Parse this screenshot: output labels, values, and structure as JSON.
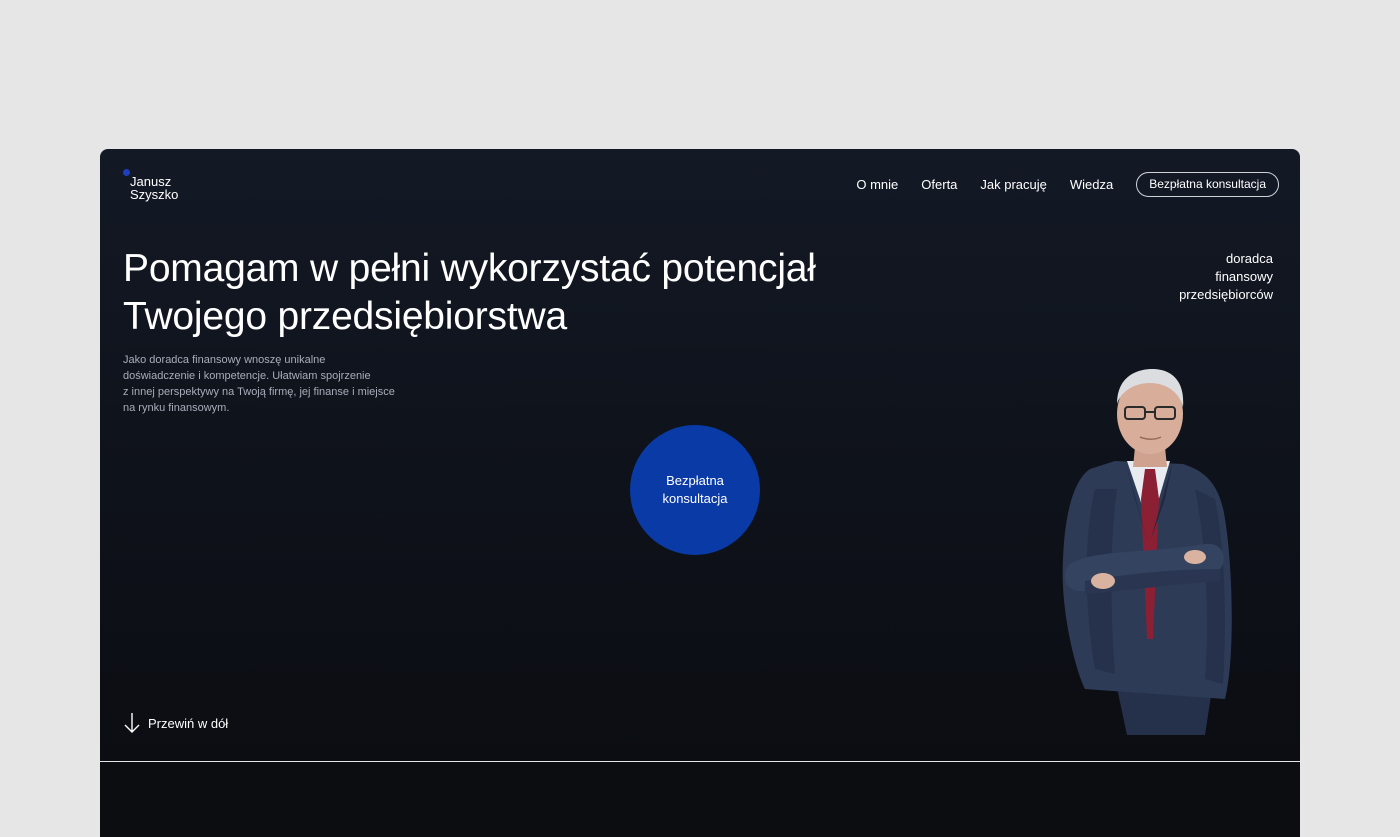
{
  "logo": {
    "line1": "Janusz",
    "line2": "Szyszko",
    "dot_color": "#1d3fbf"
  },
  "nav": {
    "items": [
      {
        "label": "O mnie"
      },
      {
        "label": "Oferta"
      },
      {
        "label": "Jak pracuję"
      },
      {
        "label": "Wiedza"
      }
    ],
    "cta_label": "Bezpłatna konsultacja"
  },
  "hero": {
    "headline_line1": "Pomagam w pełni wykorzystać potencjał",
    "headline_line2": "Twojego przedsiębiorstwa",
    "tagline": [
      "doradca",
      "finansowy",
      "przedsiębiorców"
    ],
    "intro": [
      "Jako doradca finansowy wnoszę unikalne",
      "doświadczenie i kompetencje. Ułatwiam spojrzenie",
      "z innej perspektywy na Twoją firmę, jej finanse i miejsce",
      "na rynku finansowym."
    ],
    "circle_cta": [
      "Bezpłatna",
      "konsultacja"
    ],
    "scroll_label": "Przewiń w dół",
    "portrait_icon": "businessman-portrait"
  },
  "colors": {
    "accent": "#0a3aa5",
    "background": "#0f131c",
    "page": "#e6e6e6"
  }
}
